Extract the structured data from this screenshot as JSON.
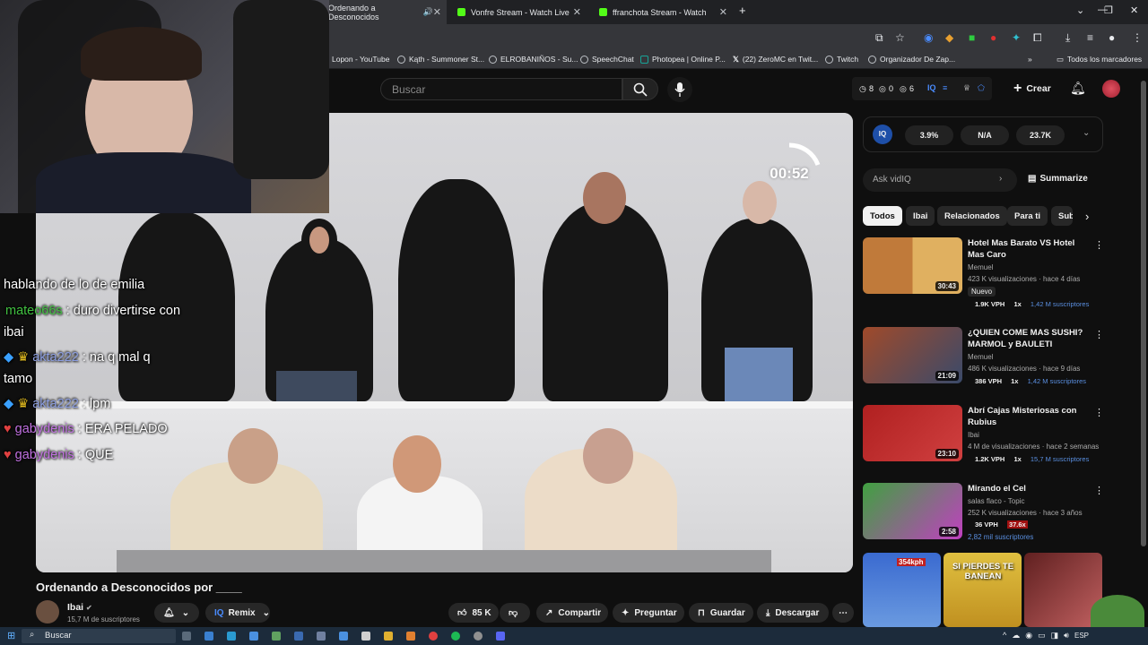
{
  "tabs": [
    {
      "title": "Ordenando a Desconocidos",
      "color": "#ff0000"
    },
    {
      "title": "Vonfre Stream - Watch Live",
      "color": "#53fc18"
    },
    {
      "title": "ffranchota Stream - Watch",
      "color": "#53fc18"
    }
  ],
  "bookmarks": [
    "Lopon - YouTube",
    "Kąth - Summoner St...",
    "ELROBANIÑOS - Su...",
    "SpeechChat",
    "Photopea | Online P...",
    "(22) ZeroMC en Twit...",
    "Twitch",
    "Organizador De Zap...",
    "Todos los marcadores"
  ],
  "yt": {
    "search_placeholder": "Buscar",
    "stats": {
      "a": "8",
      "b": "0",
      "c": "6"
    },
    "create": "Crear"
  },
  "video": {
    "timer": "00:52",
    "title": "Ordenando a Desconocidos por ____",
    "channel": "Ibai",
    "subs": "15,7 M de suscriptores",
    "remix": "Remix",
    "likes": "85 K",
    "share": "Compartir",
    "ask": "Preguntar",
    "save": "Guardar",
    "download": "Descargar"
  },
  "chat": [
    {
      "user": "",
      "text": "hablando de lo de emilia"
    },
    {
      "user": "mateo66s",
      "text": ": duro divertirse con"
    },
    {
      "user": "",
      "text": "ibai"
    },
    {
      "user": "akta222",
      "text": ": na q mal q"
    },
    {
      "user": "",
      "text": "tamo"
    },
    {
      "user": "akta222",
      "text": ": lpm"
    },
    {
      "user": "gabydenis",
      "text": ": ERA PELADO"
    },
    {
      "user": "gabydenis",
      "text": ": QUE"
    }
  ],
  "vidiq": {
    "score": "3.9%",
    "mid": "N/A",
    "views": "23.7K",
    "ask_placeholder": "Ask vidIQ",
    "summarize": "Summarize"
  },
  "chips": [
    "Todos",
    "Ibai",
    "Relacionados",
    "Para ti",
    "Sub"
  ],
  "recs": [
    {
      "title": "Hotel Mas Barato VS Hotel Mas Caro",
      "channel": "Memuel",
      "meta": "423 K visualizaciones · hace 4 días",
      "badge": "Nuevo",
      "vph": "1.9K VPH",
      "x": "1x",
      "subs": "1,42 M suscriptores",
      "dur": "30:43",
      "c1": "#c07a3a",
      "c2": "#e0b060"
    },
    {
      "title": "¿QUIEN COME MAS SUSHI? MARMOL y BAULETI",
      "channel": "Memuel",
      "meta": "486 K visualizaciones · hace 9 días",
      "vph": "386 VPH",
      "x": "1x",
      "subs": "1,42 M suscriptores",
      "dur": "21:09",
      "c1": "#a04a2a",
      "c2": "#3a4a6a"
    },
    {
      "title": "Abrí Cajas Misteriosas con Rubius",
      "channel": "Ibai",
      "meta": "4 M de visualizaciones · hace 2 semanas",
      "vph": "1.2K VPH",
      "x": "1x",
      "subs": "15,7 M suscriptores",
      "dur": "23:10",
      "c1": "#b02020",
      "c2": "#d04040"
    },
    {
      "title": "Mirando el Cel",
      "channel": "salas flaco - Topic",
      "meta": "252 K visualizaciones · hace 3 años",
      "vph": "36 VPH",
      "x": "37.6x",
      "subs": "2,82 mil suscriptores",
      "dur": "2:58",
      "c1": "#40a040",
      "c2": "#c040c0"
    }
  ],
  "shorts": [
    "354kph",
    "SI PIERDES TE BANEAN",
    ""
  ],
  "taskbar": {
    "search": "Buscar",
    "lang": "ESP"
  }
}
